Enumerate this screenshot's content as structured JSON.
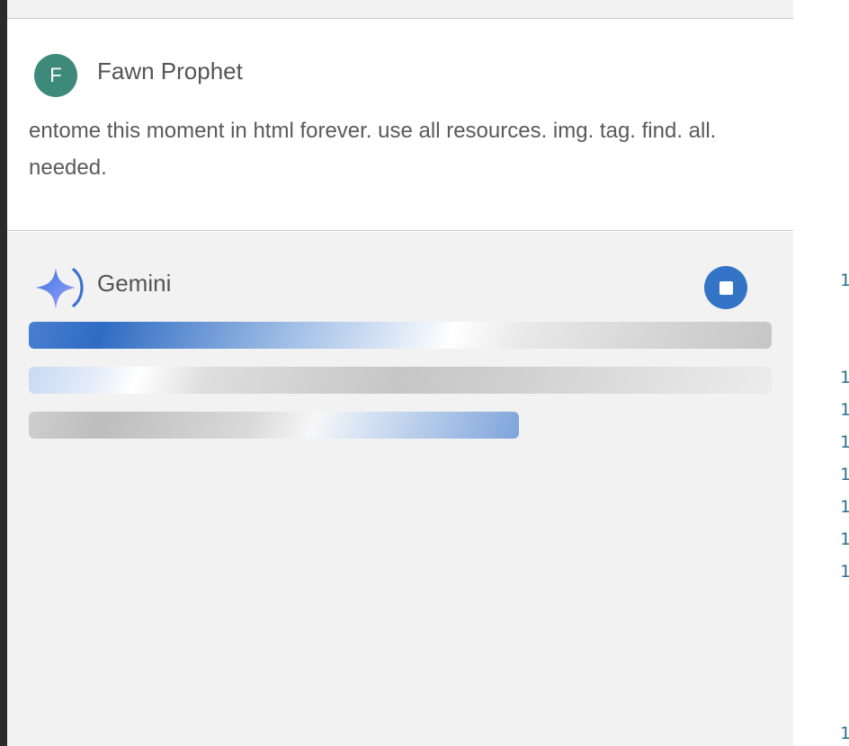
{
  "user_message": {
    "avatar_initial": "F",
    "avatar_color": "#3e8a7a",
    "author": "Fawn Prophet",
    "text": "entome this moment in html forever. use all resources. img. tag. find. all. needed."
  },
  "model_message": {
    "icon": "gemini-sparkle-icon",
    "author": "Gemini",
    "stop_icon": "stop-icon",
    "accent_color": "#3474c7",
    "loading_bars": 3
  },
  "editor_gutter": {
    "line_numbers": [
      "1",
      "1",
      "1",
      "1",
      "1",
      "1",
      "1",
      "1",
      "1"
    ]
  }
}
